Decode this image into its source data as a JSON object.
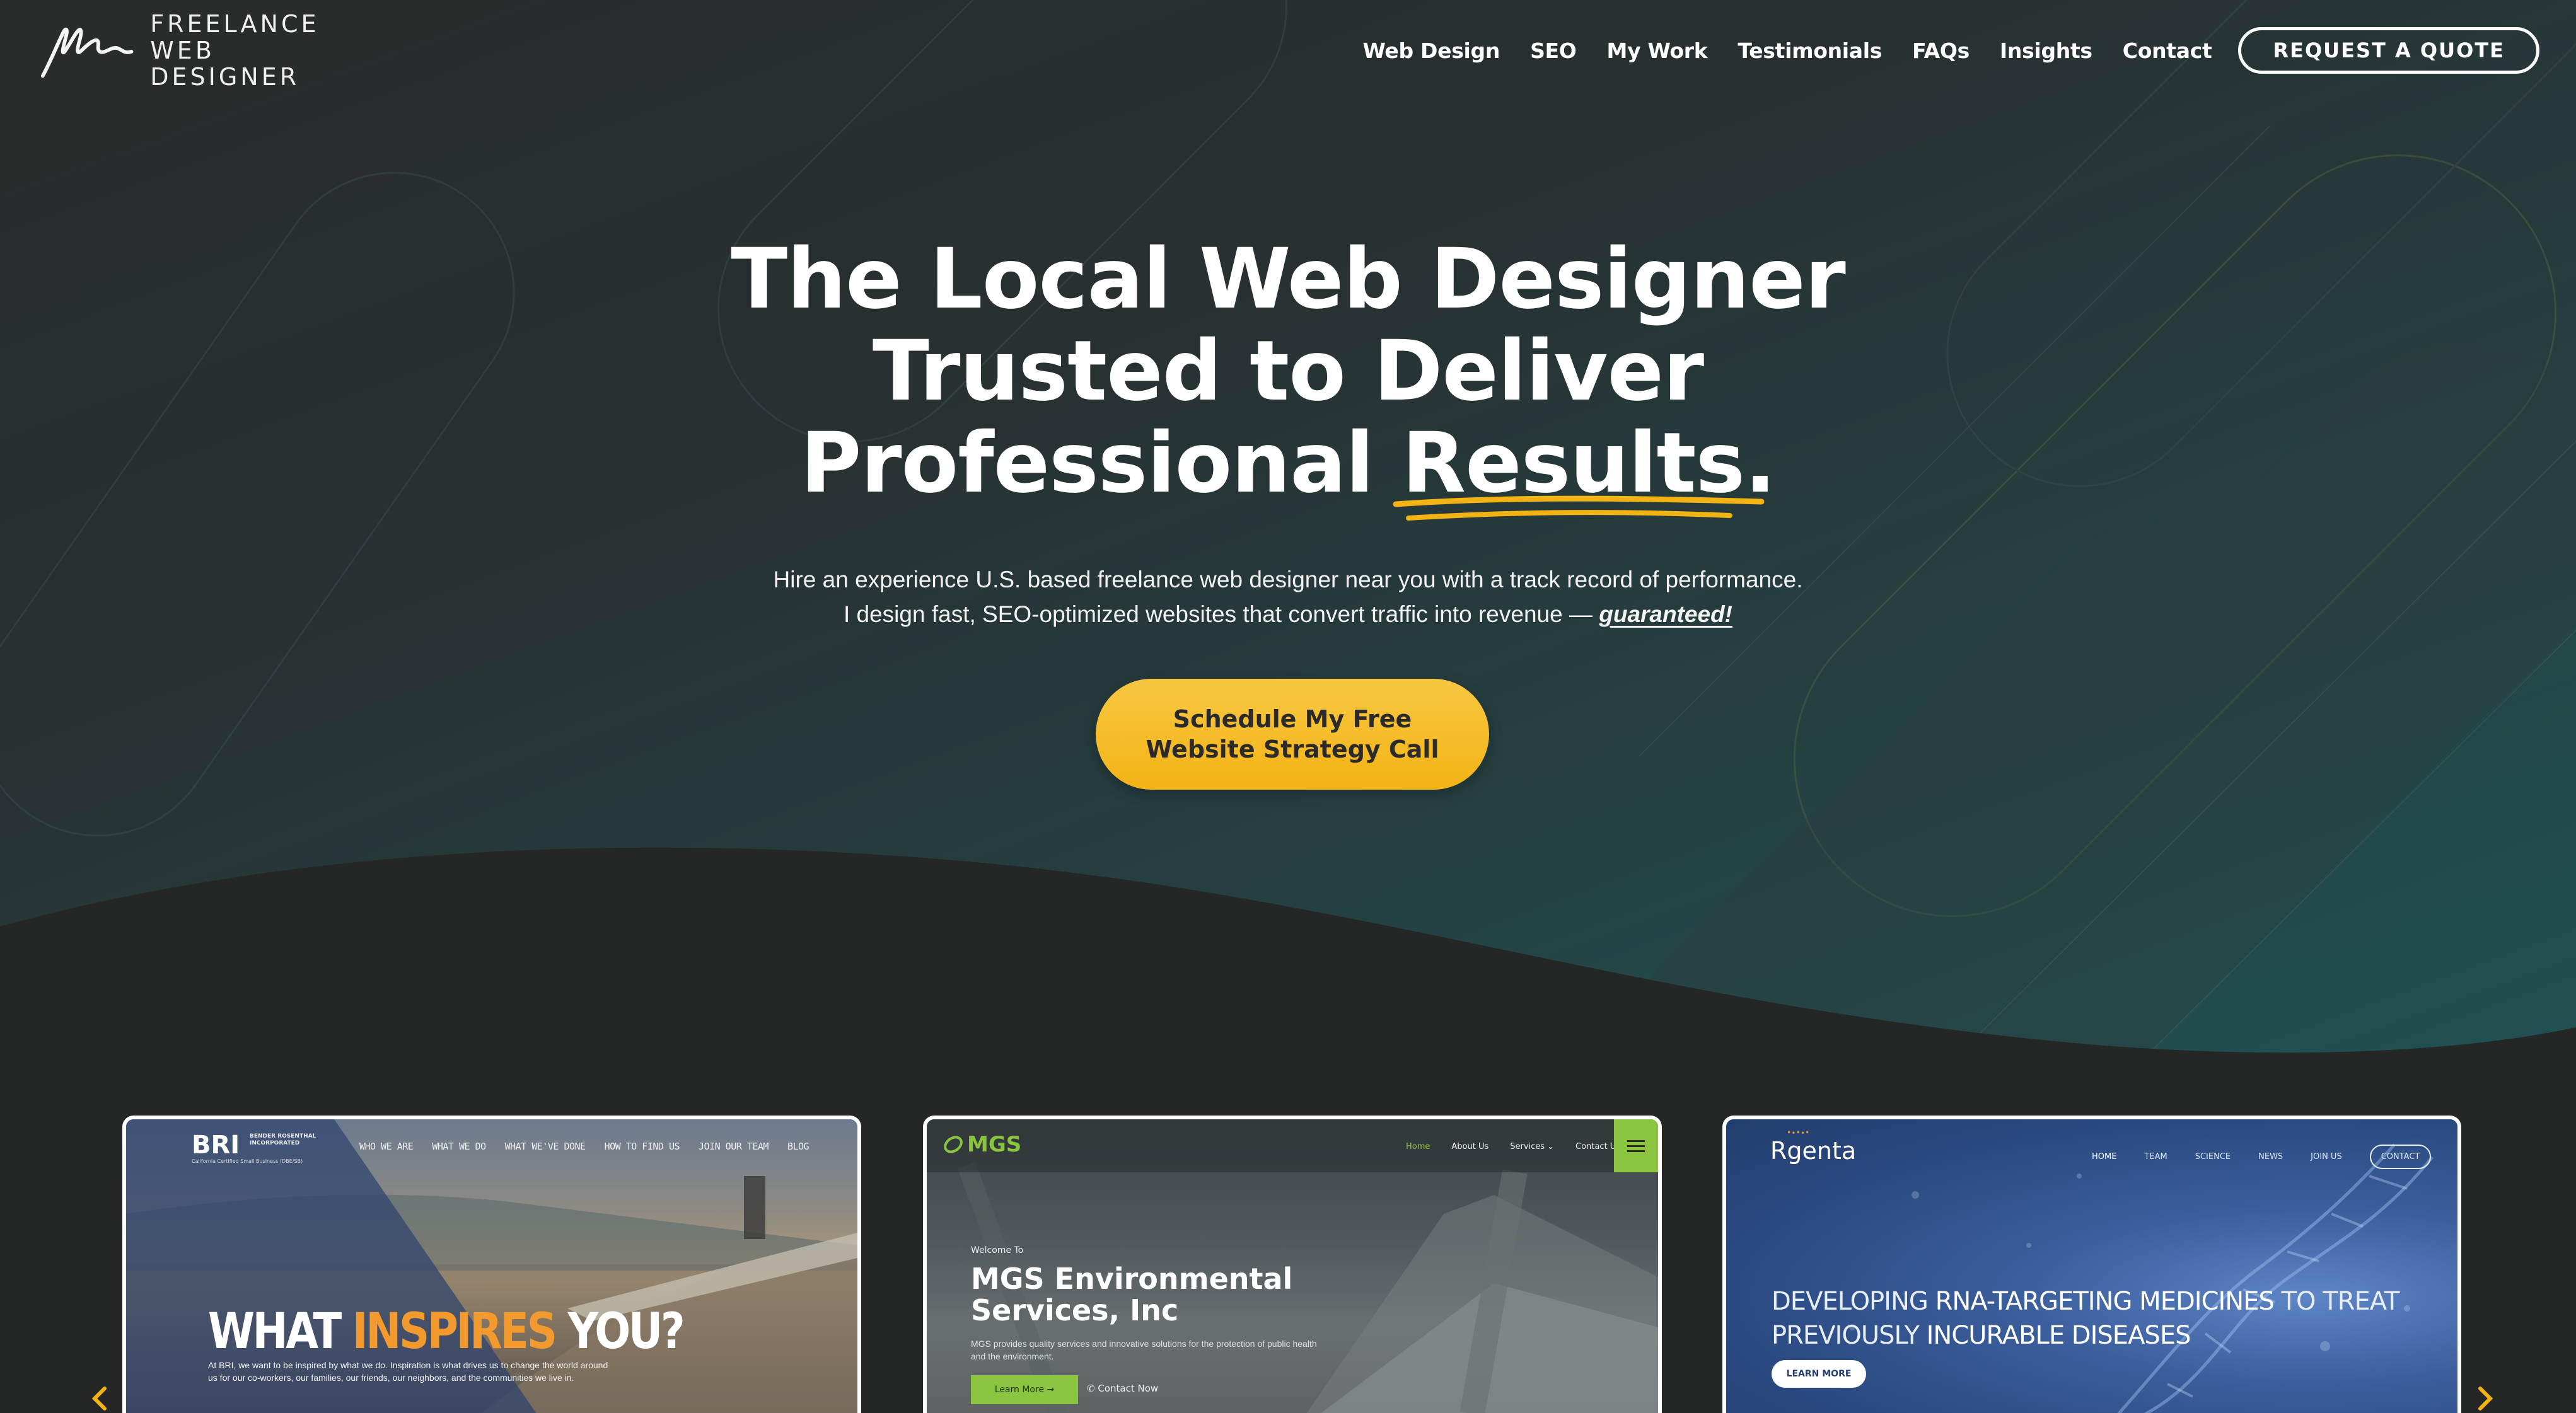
{
  "header": {
    "logo_line1": "FREELANCE",
    "logo_line2": "WEB DESIGNER",
    "nav": [
      "Web Design",
      "SEO",
      "My Work",
      "Testimonials",
      "FAQs",
      "Insights",
      "Contact"
    ],
    "quote_button": "REQUEST A QUOTE"
  },
  "hero": {
    "title_line1": "The Local Web Designer",
    "title_line2": "Trusted to Deliver",
    "title_line3_pre": "Professional ",
    "title_line3_accent": "Results.",
    "subtitle_line1": "Hire an experience U.S. based freelance web designer near you with a track record of performance.",
    "subtitle_line2_pre": "I design fast, SEO-optimized websites that convert traffic into revenue — ",
    "subtitle_line2_em": "guaranteed!",
    "cta_line1": "Schedule My Free",
    "cta_line2": "Website Strategy Call"
  },
  "portfolio": {
    "card1": {
      "logo": "BRI",
      "logo_sub": "BENDER ROSENTHAL INCORPORATED",
      "tagline": "California Certified Small Business (DBE/SB)",
      "nav": [
        "WHO WE ARE",
        "WHAT WE DO",
        "WHAT WE'VE DONE",
        "HOW TO FIND US",
        "JOIN OUR TEAM",
        "BLOG"
      ],
      "headline_pre": "WHAT ",
      "headline_accent": "INSPIRES",
      "headline_post": " YOU?",
      "body": "At BRI, we want to be inspired by what we do. Inspiration is what drives us to change the world around us for our co-workers, our families, our friends, our neighbors, and the communities we live in."
    },
    "card2": {
      "logo": "MGS",
      "nav": [
        "Home",
        "About Us",
        "Services ⌄",
        "Contact Us"
      ],
      "welcome": "Welcome To",
      "title_line1": "MGS Environmental",
      "title_line2": "Services, Inc",
      "body": "MGS provides quality services and innovative solutions for the protection of public health and the environment.",
      "button": "Learn More →",
      "contact": "Contact Now"
    },
    "card3": {
      "logo": "Rgenta",
      "logo_top": "•∙•∙•",
      "nav": [
        "HOME",
        "TEAM",
        "SCIENCE",
        "NEWS",
        "JOIN US"
      ],
      "contact": "CONTACT",
      "headline_a": "DEVELOPING ",
      "headline_b": "RNA-TARGETING MEDICINES",
      "headline_c": " TO TREAT",
      "headline_d": "PREVIOUSLY ",
      "headline_e": "INCURABLE DISEASES",
      "button": "LEARN MORE"
    }
  },
  "colors": {
    "accent": "#f4b315",
    "background": "#252626",
    "teal": "#205152",
    "green": "#8bc53f"
  },
  "icons": [
    "signature-logo-icon",
    "squiggle-underline-icon",
    "chevron-left-icon",
    "chevron-right-icon",
    "hamburger-icon",
    "phone-icon"
  ]
}
